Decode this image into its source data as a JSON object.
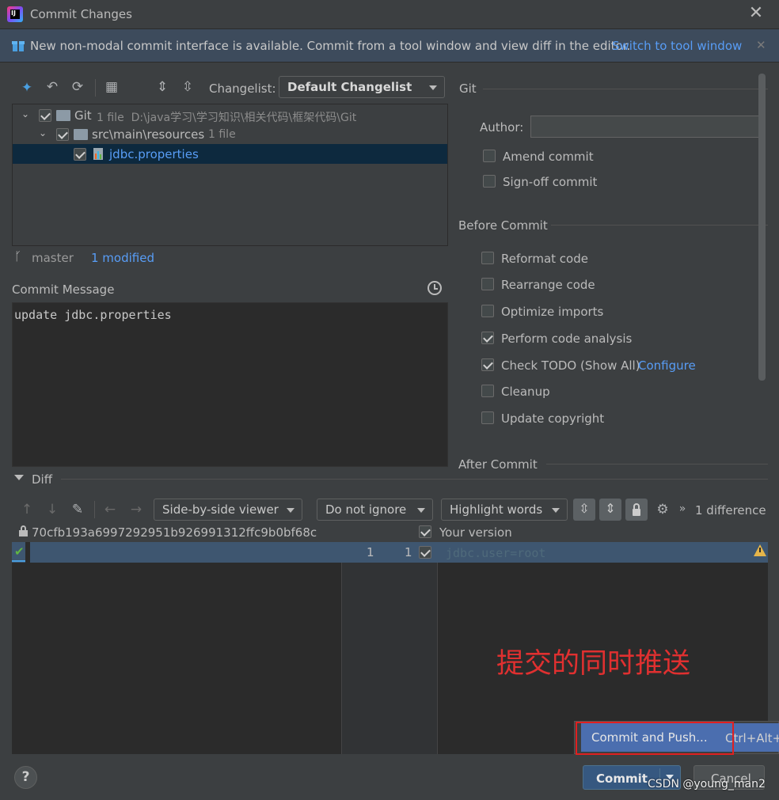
{
  "window": {
    "title": "Commit Changes"
  },
  "banner": {
    "text": "New non-modal commit interface is available. Commit from a tool window and view diff in the editor.",
    "link": "Switch to tool window"
  },
  "toolbar": {
    "changelist_label": "Changelist:",
    "changelist_value": "Default Changelist"
  },
  "tree": [
    {
      "label": "Git",
      "meta": "1 file  D:\\java学习\\学习知识\\相关代码\\框架代码\\Git"
    },
    {
      "label": "src\\main\\resources",
      "meta": "1 file"
    },
    {
      "label": "jdbc.properties",
      "meta": ""
    }
  ],
  "status": {
    "branch": "master",
    "modified": "1 modified"
  },
  "commit_message": {
    "label": "Commit Message",
    "value": "update jdbc.properties"
  },
  "git": {
    "section": "Git",
    "author_label": "Author:",
    "author_value": "",
    "options": [
      {
        "label": "Amend commit",
        "checked": false
      },
      {
        "label": "Sign-off commit",
        "checked": false
      }
    ]
  },
  "before_commit": {
    "section": "Before Commit",
    "options": [
      {
        "label": "Reformat code",
        "checked": false
      },
      {
        "label": "Rearrange code",
        "checked": false
      },
      {
        "label": "Optimize imports",
        "checked": false
      },
      {
        "label": "Perform code analysis",
        "checked": true
      },
      {
        "label": "Check TODO (Show All)",
        "checked": true,
        "link": "Configure"
      },
      {
        "label": "Cleanup",
        "checked": false
      },
      {
        "label": "Update copyright",
        "checked": false
      }
    ]
  },
  "after_commit": {
    "section": "After Commit"
  },
  "diff": {
    "section": "Diff",
    "viewer": "Side-by-side viewer",
    "ignore": "Do not ignore",
    "highlight": "Highlight words",
    "differences": "1 difference",
    "left_hash": "70cfb193a6997292951b926991312ffc9b0bf68c",
    "right_label": "Your version",
    "left_line": "1",
    "right_line": "1",
    "content": "jdbc.user=root"
  },
  "annotation": "提交的同时推送",
  "popup": {
    "item": "Commit and Push...",
    "shortcut": "Ctrl+Alt+"
  },
  "footer": {
    "help": "?",
    "commit": "Commit",
    "cancel": "Cancel",
    "watermark": "CSDN @young_man2"
  }
}
